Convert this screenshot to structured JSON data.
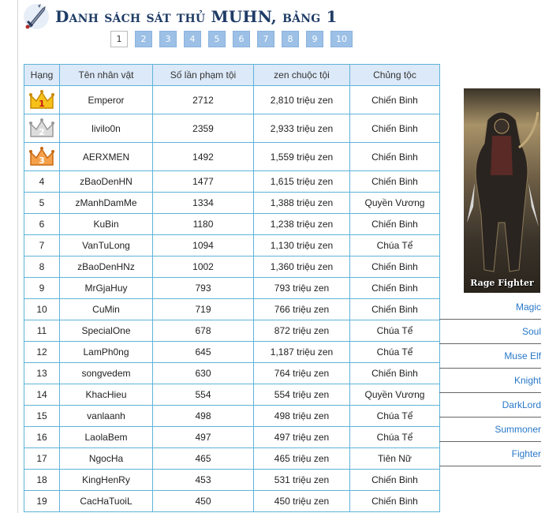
{
  "header": {
    "title": "Danh sách sát thủ MUHN, bảng 1",
    "logo_icon": "sword-icon"
  },
  "pager": {
    "current": "1",
    "pages": [
      "2",
      "3",
      "4",
      "5",
      "6",
      "7",
      "8",
      "9",
      "10"
    ]
  },
  "table": {
    "columns": [
      "Hạng",
      "Tên nhân vật",
      "Số lần phạm tội",
      "zen chuộc tội",
      "Chủng tộc"
    ],
    "rows": [
      {
        "rank": "1",
        "crown": "gold",
        "name": "Emperor",
        "count": "2712",
        "zen": "2,810 triệu zen",
        "race": "Chiến Binh",
        "race_color": "red"
      },
      {
        "rank": "2",
        "crown": "silver",
        "name": "livilo0n",
        "count": "2359",
        "zen": "2,933 triệu zen",
        "race": "Chiến Binh",
        "race_color": "red"
      },
      {
        "rank": "3",
        "crown": "bronze",
        "name": "AERXMEN",
        "count": "1492",
        "zen": "1,559 triệu zen",
        "race": "Chiến Binh",
        "race_color": "red"
      },
      {
        "rank": "4",
        "name": "zBaoDenHN",
        "count": "1477",
        "zen": "1,615 triệu zen",
        "race": "Chiến Binh",
        "race_color": "red"
      },
      {
        "rank": "5",
        "name": "zManhDamMe",
        "count": "1334",
        "zen": "1,388 triệu zen",
        "race": "Quyền Vương",
        "race_color": "red"
      },
      {
        "rank": "6",
        "name": "KuBin",
        "count": "1180",
        "zen": "1,238 triệu zen",
        "race": "Chiến Binh",
        "race_color": "red"
      },
      {
        "rank": "7",
        "name": "VanTuLong",
        "count": "1094",
        "zen": "1,130 triệu zen",
        "race": "Chúa Tể",
        "race_color": "navy"
      },
      {
        "rank": "8",
        "name": "zBaoDenHNz",
        "count": "1002",
        "zen": "1,360 triệu zen",
        "race": "Chiến Binh",
        "race_color": "red"
      },
      {
        "rank": "9",
        "name": "MrGjaHuy",
        "count": "793",
        "zen": "793 triệu zen",
        "race": "Chiến Binh",
        "race_color": "red"
      },
      {
        "rank": "10",
        "name": "CuMin",
        "count": "719",
        "zen": "766 triệu zen",
        "race": "Chiến Binh",
        "race_color": "red"
      },
      {
        "rank": "11",
        "name": "SpecialOne",
        "count": "678",
        "zen": "872 triệu zen",
        "race": "Chúa Tể",
        "race_color": "navy"
      },
      {
        "rank": "12",
        "name": "LamPh0ng",
        "count": "645",
        "zen": "1,187 triệu zen",
        "race": "Chúa Tể",
        "race_color": "navy"
      },
      {
        "rank": "13",
        "name": "songvedem",
        "count": "630",
        "zen": "764 triệu zen",
        "race": "Chiến Binh",
        "race_color": "red"
      },
      {
        "rank": "14",
        "name": "KhacHieu",
        "count": "554",
        "zen": "554 triệu zen",
        "race": "Quyền Vương",
        "race_color": "red"
      },
      {
        "rank": "15",
        "name": "vanlaanh",
        "count": "498",
        "zen": "498 triệu zen",
        "race": "Chúa Tể",
        "race_color": "navy"
      },
      {
        "rank": "16",
        "name": "LaolaBem",
        "count": "497",
        "zen": "497 triệu zen",
        "race": "Chúa Tể",
        "race_color": "navy"
      },
      {
        "rank": "17",
        "name": "NgocHa",
        "count": "465",
        "zen": "465 triệu zen",
        "race": "Tiên Nữ",
        "race_color": "pink"
      },
      {
        "rank": "18",
        "name": "KingHenRy",
        "count": "453",
        "zen": "531 triệu zen",
        "race": "Chiến Binh",
        "race_color": "red"
      },
      {
        "rank": "19",
        "name": "CacHaTuoiL",
        "count": "450",
        "zen": "450 triệu zen",
        "race": "Chiến Binh",
        "race_color": "red"
      }
    ]
  },
  "side": {
    "image_caption": "Rage Fighter",
    "classes": [
      "Magic",
      "Soul",
      "Muse Elf",
      "Knight",
      "DarkLord",
      "Summoner",
      "Fighter"
    ]
  },
  "colors": {
    "title": "#1f3c66",
    "red": "#c8102e",
    "navy": "#1a2b4a",
    "pink": "#e020c0",
    "link": "#2878c8",
    "grid": "#5fb3d9"
  }
}
